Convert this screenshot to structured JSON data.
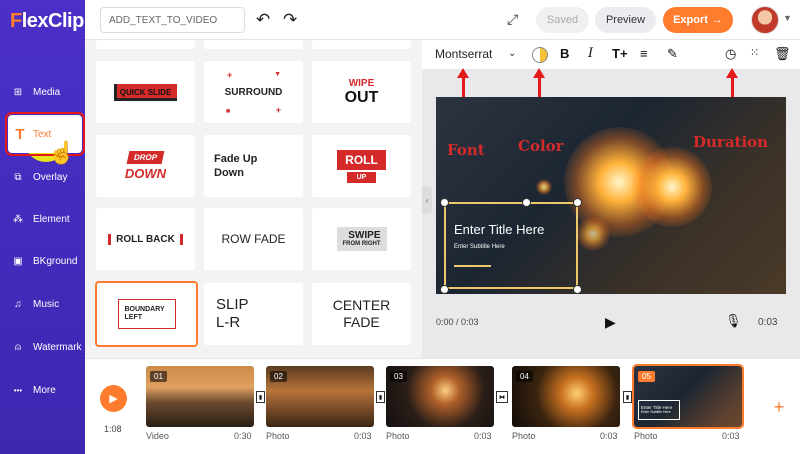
{
  "app": {
    "logo_first": "F",
    "logo_rest": "lexClip"
  },
  "topbar": {
    "project_name": "ADD_TEXT_TO_VIDEO",
    "undo_icon": "undo-icon",
    "redo_icon": "redo-icon",
    "saved_label": "Saved",
    "preview_label": "Preview",
    "export_label": "Export",
    "export_icon": "→"
  },
  "sidebar": {
    "items": [
      {
        "label": "Media",
        "icon": "media-icon",
        "glyph": "⊞"
      },
      {
        "label": "Text",
        "icon": "text-icon",
        "glyph": "T"
      },
      {
        "label": "Overlay",
        "icon": "overlay-icon",
        "glyph": "⧉"
      },
      {
        "label": "Element",
        "icon": "element-icon",
        "glyph": "⁂"
      },
      {
        "label": "BKground",
        "icon": "background-icon",
        "glyph": "▣"
      },
      {
        "label": "Music",
        "icon": "music-icon",
        "glyph": "♫"
      },
      {
        "label": "Watermark",
        "icon": "watermark-icon",
        "glyph": "⍝"
      },
      {
        "label": "More",
        "icon": "more-icon",
        "glyph": "•••"
      }
    ],
    "active": "Text"
  },
  "templates": [
    {
      "key": "quick_slide",
      "text": "QUICK SLIDE"
    },
    {
      "key": "surround",
      "text": "SURROUND"
    },
    {
      "key": "wipe_out",
      "top": "WIPE",
      "bottom": "OUT"
    },
    {
      "key": "drop_down",
      "top": "DROP",
      "bottom": "DOWN"
    },
    {
      "key": "fade_up_down",
      "top": "Fade Up",
      "bottom": "Down"
    },
    {
      "key": "roll_up",
      "top": "ROLL",
      "bottom": "UP"
    },
    {
      "key": "roll_back",
      "text": "ROLL BACK"
    },
    {
      "key": "row_fade",
      "text": "ROW FADE"
    },
    {
      "key": "swipe_from_right",
      "top": "SWIPE",
      "bottom": "FROM RIGHT"
    },
    {
      "key": "boundary_left",
      "top": "BOUNDARY",
      "bottom": "LEFT"
    },
    {
      "key": "slip_lr",
      "top": "SLIP",
      "bottom": "L-R"
    },
    {
      "key": "center_fade",
      "top": "CENTER",
      "bottom": "FADE"
    }
  ],
  "toolbar": {
    "font": "Montserrat",
    "color_value": "#f5c23a"
  },
  "canvas": {
    "title": "Enter Title Here",
    "subtitle": "Enter Subtitle Here",
    "annotations": {
      "font": "Font",
      "color": "Color",
      "duration": "Duration"
    }
  },
  "player": {
    "current": "0:00 / 0:03",
    "end": "0:03"
  },
  "timeline": {
    "total_time": "1:08",
    "clips": [
      {
        "num": "01",
        "type": "Video",
        "duration": "0:30"
      },
      {
        "num": "02",
        "type": "Photo",
        "duration": "0:03"
      },
      {
        "num": "03",
        "type": "Photo",
        "duration": "0:03"
      },
      {
        "num": "04",
        "type": "Photo",
        "duration": "0:03"
      },
      {
        "num": "05",
        "type": "Photo",
        "duration": "0:03",
        "mini_title": "Enter Title Here",
        "mini_subtitle": "Enter Subtitle Here"
      }
    ]
  },
  "colors": {
    "brand": "#4b2fc8",
    "accent": "#ff7b2e",
    "annotation": "#d42a2a"
  }
}
